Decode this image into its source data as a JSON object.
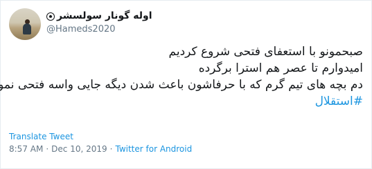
{
  "user": {
    "display_name": "اوله گونار سولسشر",
    "emoji": "soccer-ball-icon",
    "handle": "@Hameds2020"
  },
  "tweet": {
    "lines": [
      "صبحمونو با استعفای فتحی شروع کردیم",
      "امیدوارم تا عصر هم استرا برگرده",
      "دم بچه های تیم گرم که با حرفاشون باعث شدن دیگه جایی واسه فتحی نمونه"
    ],
    "hashtag": "#استقلال"
  },
  "translate_label": "Translate Tweet",
  "meta": {
    "time": "8:57 AM",
    "separator1": "·",
    "date": "Dec 10, 2019",
    "separator2": "·",
    "client": "Twitter for Android"
  },
  "colors": {
    "link": "#1b95e0",
    "secondary": "#657786",
    "text": "#14171a"
  }
}
